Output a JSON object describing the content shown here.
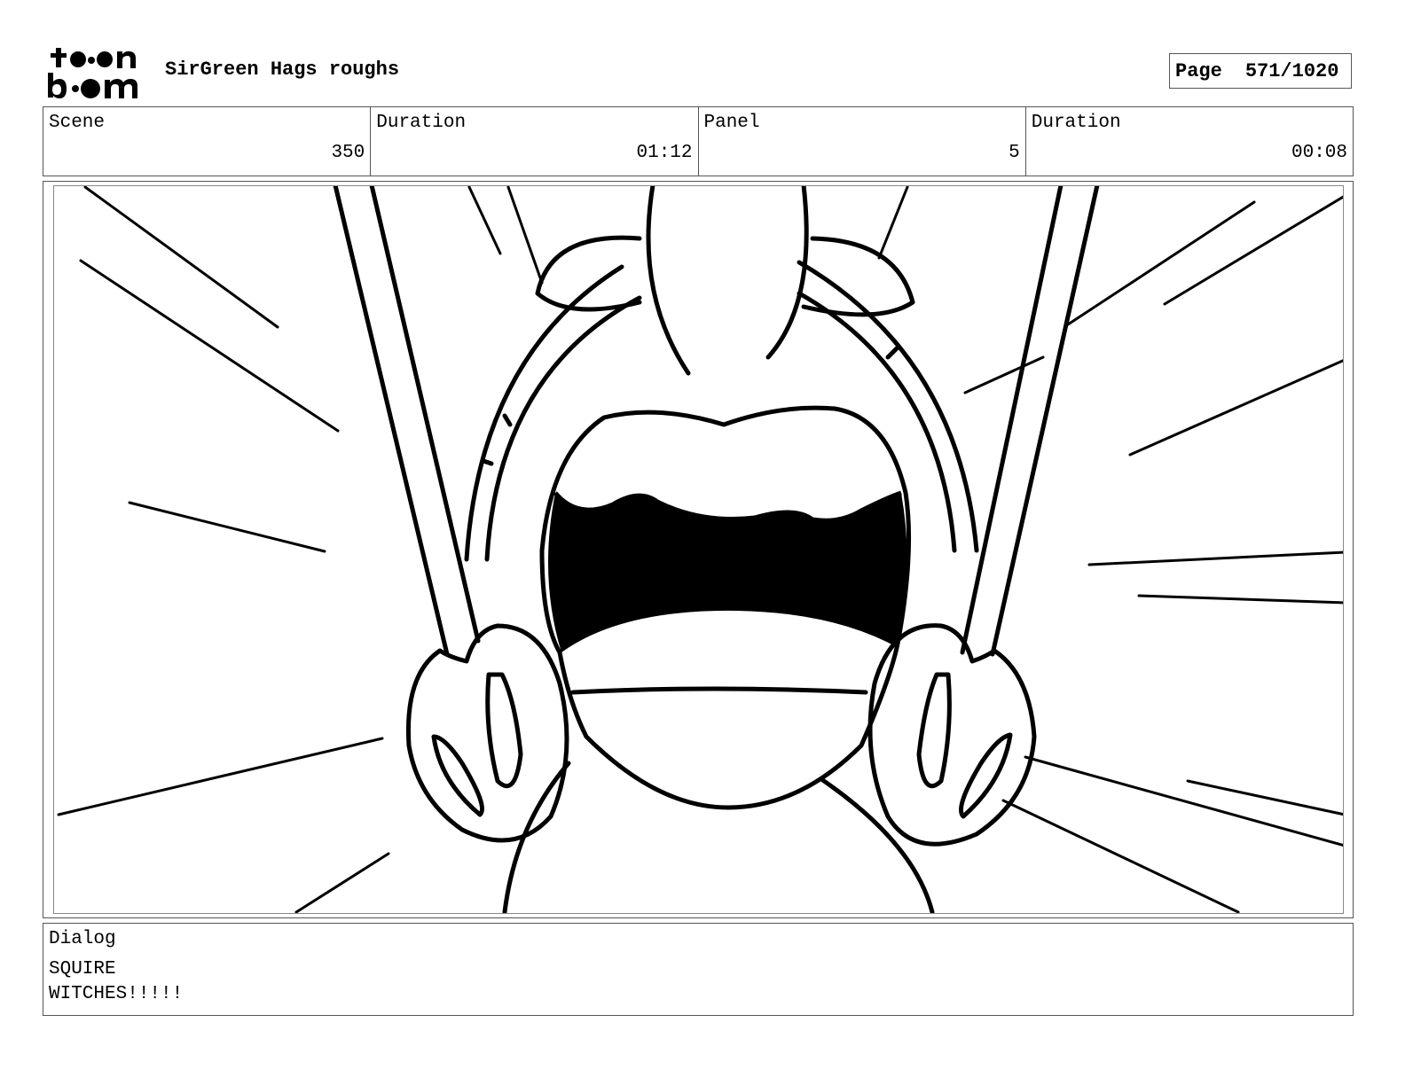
{
  "header": {
    "project_title": "SirGreen Hags roughs",
    "page_label": "Page",
    "page_number": "571/1020"
  },
  "info": {
    "scene_label": "Scene",
    "scene_value": "350",
    "scene_duration_label": "Duration",
    "scene_duration_value": "01:12",
    "panel_label": "Panel",
    "panel_value": "5",
    "panel_duration_label": "Duration",
    "panel_duration_value": "00:08"
  },
  "dialog": {
    "label": "Dialog",
    "speaker": "SQUIRE",
    "line": "WITCHES!!!!!"
  }
}
